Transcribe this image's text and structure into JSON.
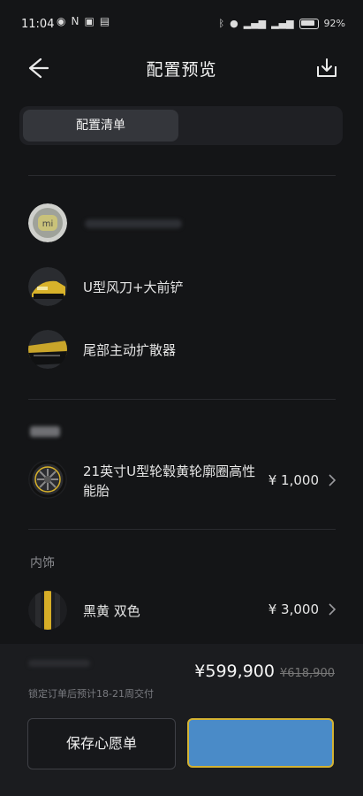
{
  "status_bar": {
    "time": "11:04",
    "battery": "92%"
  },
  "header": {
    "title": "配置预览"
  },
  "tabs": [
    {
      "label": "配置清单",
      "active": true
    },
    {
      "label": "",
      "active": false
    }
  ],
  "exterior_items": [
    {
      "label": "",
      "icon": "mi-logo"
    },
    {
      "label": "U型风刀+大前铲"
    },
    {
      "label": "尾部主动扩散器"
    }
  ],
  "wheels": {
    "label": "21英寸U型轮毂黄轮廓圈高性能胎",
    "price": "¥ 1,000"
  },
  "interior": {
    "section": "内饰",
    "label": "黑黄 双色",
    "price": "¥ 3,000"
  },
  "bottom": {
    "total": "¥599,900",
    "original": "¥618,900",
    "delivery": "锁定订单后预计18-21周交付",
    "save_label": "保存心愿单"
  },
  "colors": {
    "accent": "#4a8bc8",
    "highlight": "#d3b233",
    "background": "#141517"
  }
}
